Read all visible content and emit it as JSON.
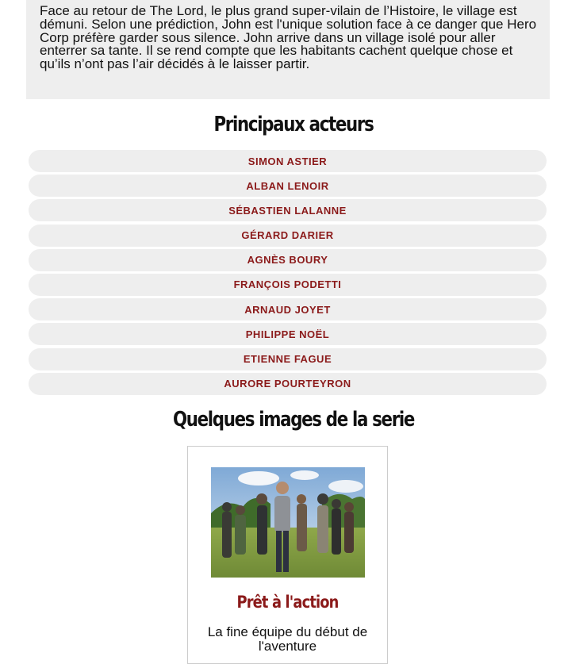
{
  "synopsis": {
    "text": "Face au retour de The Lord, le plus grand super-vilain de l’Histoire, le village est démuni. Selon une prédiction, John est l'unique solution face à ce danger que Hero Corp préfère garder sous silence. John arrive dans un village isolé pour aller enterrer sa tante. Il se rend compte que les habitants cachent quelque chose et qu’ils n’ont pas l’air décidés à le laisser partir."
  },
  "actors": {
    "title": "Principaux acteurs",
    "items": [
      "SIMON ASTIER",
      "ALBAN LENOIR",
      "SÉBASTIEN LALANNE",
      "GÉRARD DARIER",
      "AGNÈS BOURY",
      "FRANÇOIS PODETTI",
      "ARNAUD JOYET",
      "PHILIPPE NOËL",
      "ETIENNE FAGUE",
      "AURORE POURTEYRON"
    ]
  },
  "gallery": {
    "title": "Quelques images de la serie",
    "cards": [
      {
        "title": "Prêt à l'action",
        "caption": "La fine équipe du début de l'aventure"
      }
    ]
  },
  "colors": {
    "accent": "#8b1a1a",
    "panel": "#eeeeee"
  }
}
